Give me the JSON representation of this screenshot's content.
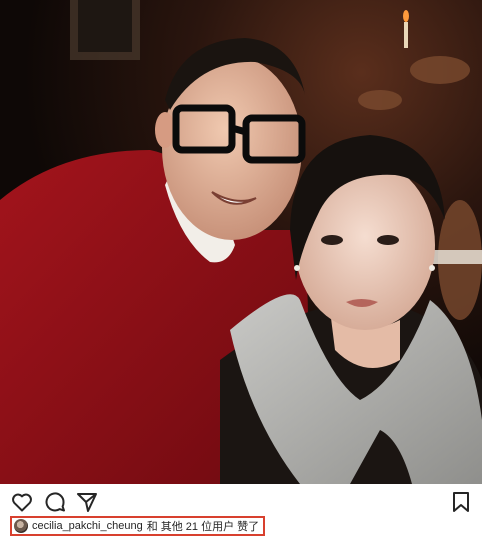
{
  "post": {
    "likes": {
      "liker_username": "cecilia_pakchi_cheung",
      "summary_text": " 和 其他 21 位用户 赞了"
    },
    "icons": {
      "like": "heart-icon",
      "comment": "comment-bubble-icon",
      "share": "paper-plane-icon",
      "save": "bookmark-icon"
    }
  }
}
